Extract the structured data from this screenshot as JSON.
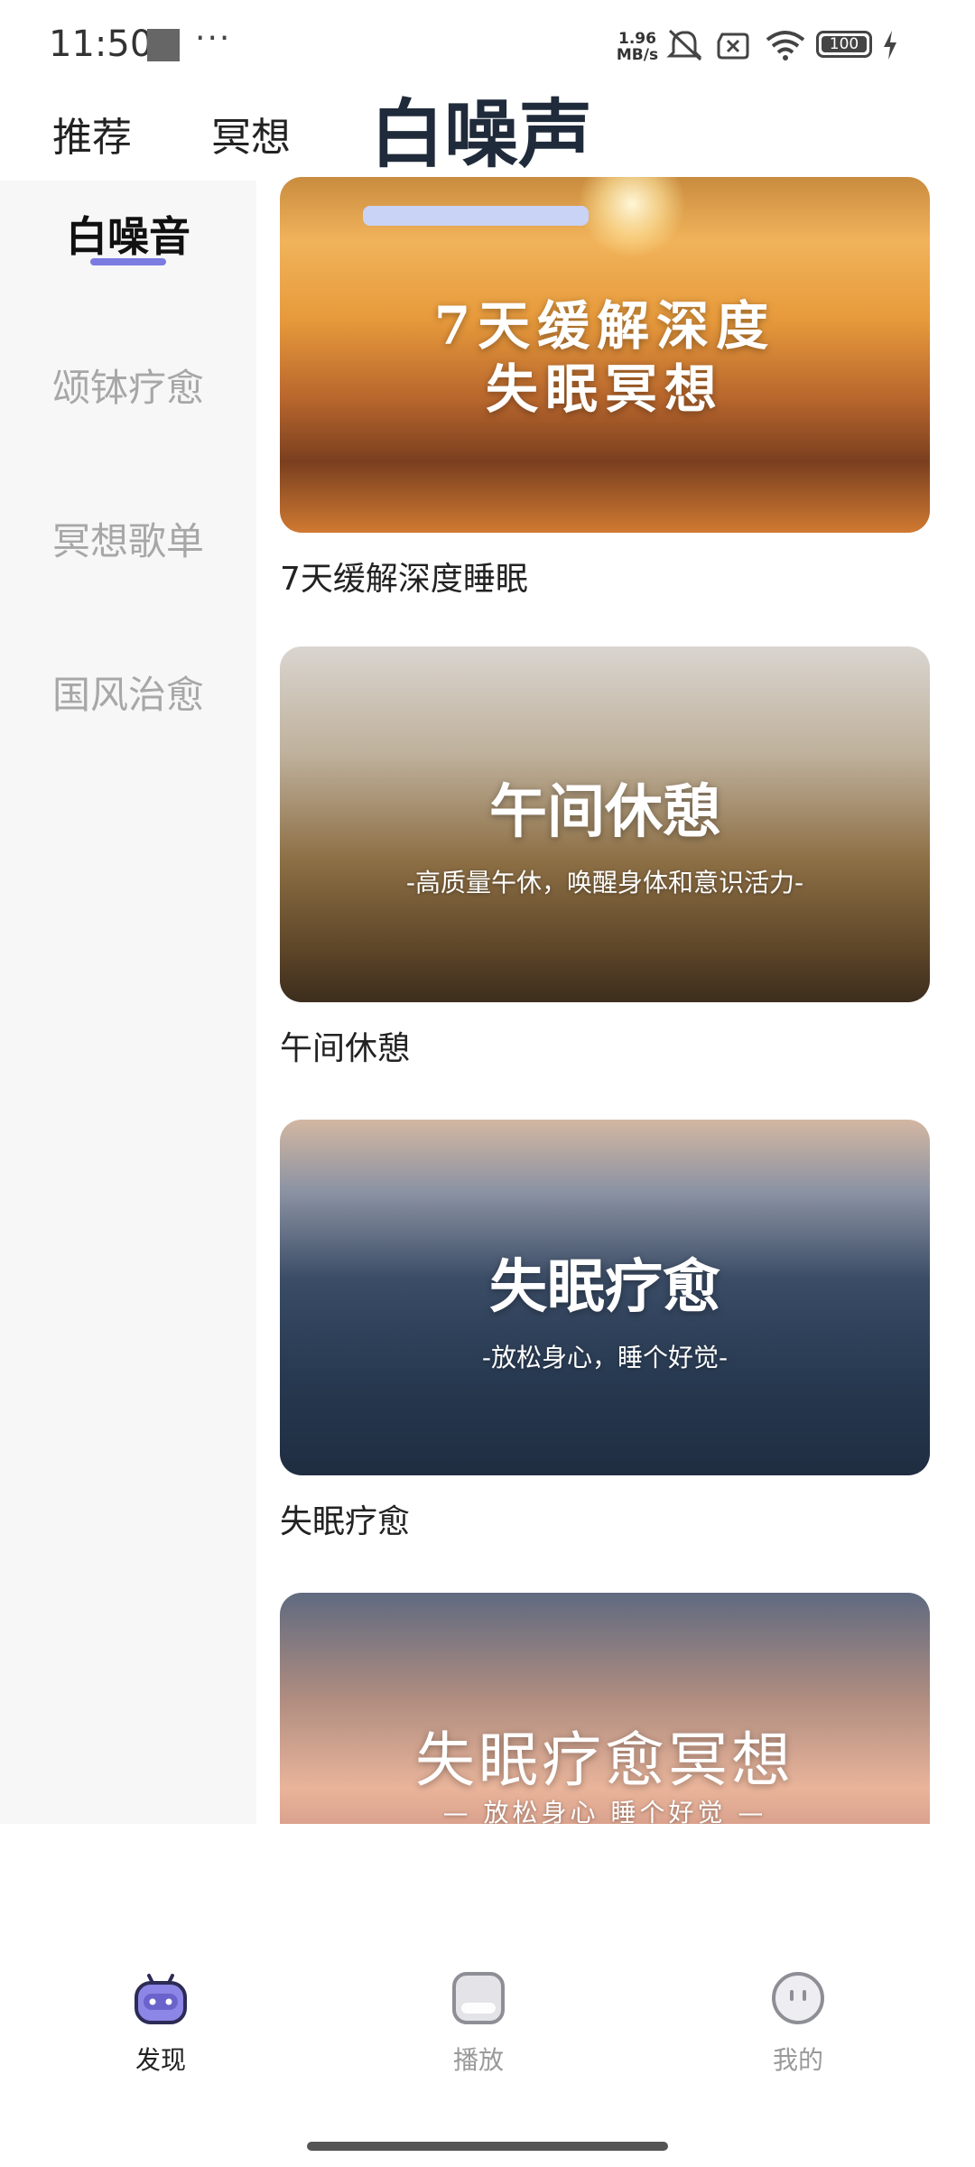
{
  "status_bar": {
    "time": "11:50",
    "more": "···",
    "net_speed_value": "1.96",
    "net_speed_unit": "MB/s",
    "battery": "100",
    "icons": [
      "app-notification-icon",
      "mute-icon",
      "sim-error-icon",
      "wifi-icon",
      "battery-icon",
      "charging-icon"
    ]
  },
  "top_tabs": [
    {
      "label": "推荐"
    },
    {
      "label": "冥想"
    },
    {
      "label": "白噪声"
    }
  ],
  "active_tab_index": 2,
  "sidebar": {
    "items": [
      {
        "label": "白噪音"
      },
      {
        "label": "颂钵疗愈"
      },
      {
        "label": "冥想歌单"
      },
      {
        "label": "国风治愈"
      }
    ],
    "active_index": 0
  },
  "cards": [
    {
      "overlay_line1": "7天缓解深度",
      "overlay_line2": "失眠冥想",
      "subtitle": "",
      "caption": "7天缓解深度睡眠"
    },
    {
      "overlay_line1": "午间休憩",
      "overlay_line2": "",
      "subtitle": "-高质量午休，唤醒身体和意识活力-",
      "caption": "午间休憩"
    },
    {
      "overlay_line1": "失眠疗愈",
      "overlay_line2": "",
      "subtitle": "-放松身心，睡个好觉-",
      "caption": "失眠疗愈"
    },
    {
      "overlay_line1": "失眠疗愈冥想",
      "overlay_line2": "",
      "subtitle": "— 放松身心 睡个好觉 —",
      "caption": ""
    }
  ],
  "bottom_nav": {
    "items": [
      {
        "label": "发现",
        "icon": "robot-face-icon"
      },
      {
        "label": "播放",
        "icon": "player-icon"
      },
      {
        "label": "我的",
        "icon": "profile-face-icon"
      }
    ],
    "active_index": 0
  },
  "colors": {
    "accent": "#7b7be2",
    "tab_highlight": "#c9d3f5",
    "sidebar_bg": "#f7f7f7"
  }
}
